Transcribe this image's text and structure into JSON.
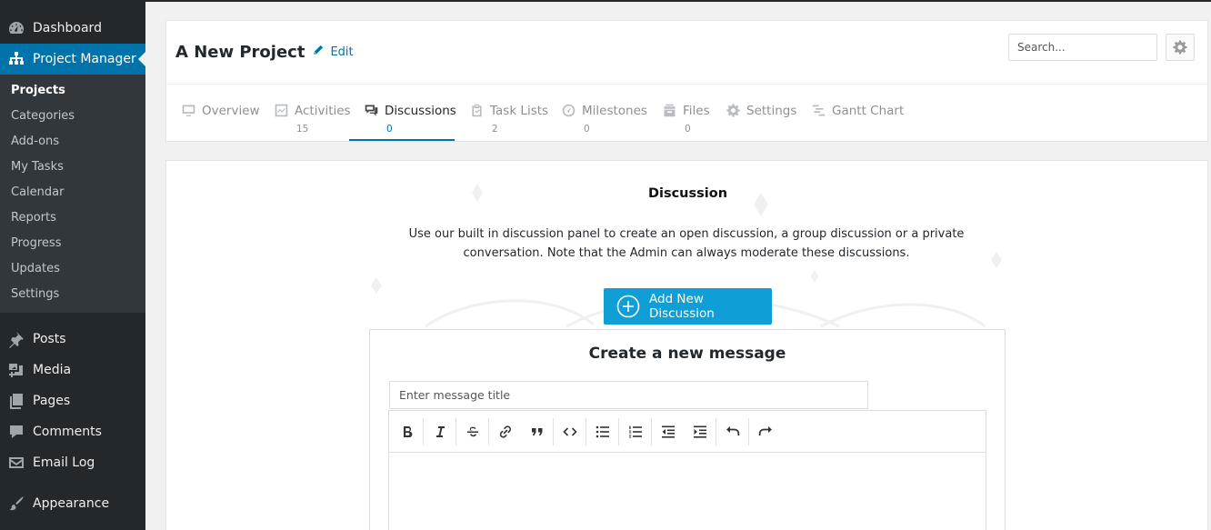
{
  "sidebar": {
    "top_items": [
      {
        "label": "Dashboard",
        "icon": "dashboard-icon"
      },
      {
        "label": "Project Manager",
        "icon": "sitemap-icon"
      }
    ],
    "submenu": [
      "Projects",
      "Categories",
      "Add-ons",
      "My Tasks",
      "Calendar",
      "Reports",
      "Progress",
      "Updates",
      "Settings"
    ],
    "lower_items": [
      {
        "label": "Posts",
        "icon": "pin-icon"
      },
      {
        "label": "Media",
        "icon": "media-icon"
      },
      {
        "label": "Pages",
        "icon": "pages-icon"
      },
      {
        "label": "Comments",
        "icon": "comment-icon"
      },
      {
        "label": "Email Log",
        "icon": "email-icon"
      },
      {
        "label": "Appearance",
        "icon": "brush-icon"
      }
    ],
    "accent": "#0073aa"
  },
  "project": {
    "title": "A New Project",
    "edit_label": "Edit"
  },
  "search": {
    "placeholder": "Search..."
  },
  "tabs": [
    {
      "label": "Overview",
      "count": "",
      "icon": "monitor-icon"
    },
    {
      "label": "Activities",
      "count": "15",
      "icon": "activity-icon"
    },
    {
      "label": "Discussions",
      "count": "0",
      "icon": "chat-icon"
    },
    {
      "label": "Task Lists",
      "count": "2",
      "icon": "clipboard-icon"
    },
    {
      "label": "Milestones",
      "count": "0",
      "icon": "gauge-icon"
    },
    {
      "label": "Files",
      "count": "0",
      "icon": "files-icon"
    },
    {
      "label": "Settings",
      "count": "",
      "icon": "gear-icon"
    },
    {
      "label": "Gantt Chart",
      "count": "",
      "icon": "gantt-icon"
    }
  ],
  "discussion": {
    "heading": "Discussion",
    "description": "Use our built in discussion panel to create an open discussion, a group discussion or a private conversation. Note that the Admin can always moderate these discussions.",
    "add_button": "Add New Discussion",
    "button_color": "#0f9fd6"
  },
  "message_form": {
    "heading": "Create a new message",
    "title_placeholder": "Enter message title",
    "toolbar": [
      "bold",
      "italic",
      "strikethrough",
      "link",
      "blockquote",
      "code",
      "bullet-list",
      "numbered-list",
      "outdent",
      "indent",
      "undo",
      "redo"
    ]
  }
}
